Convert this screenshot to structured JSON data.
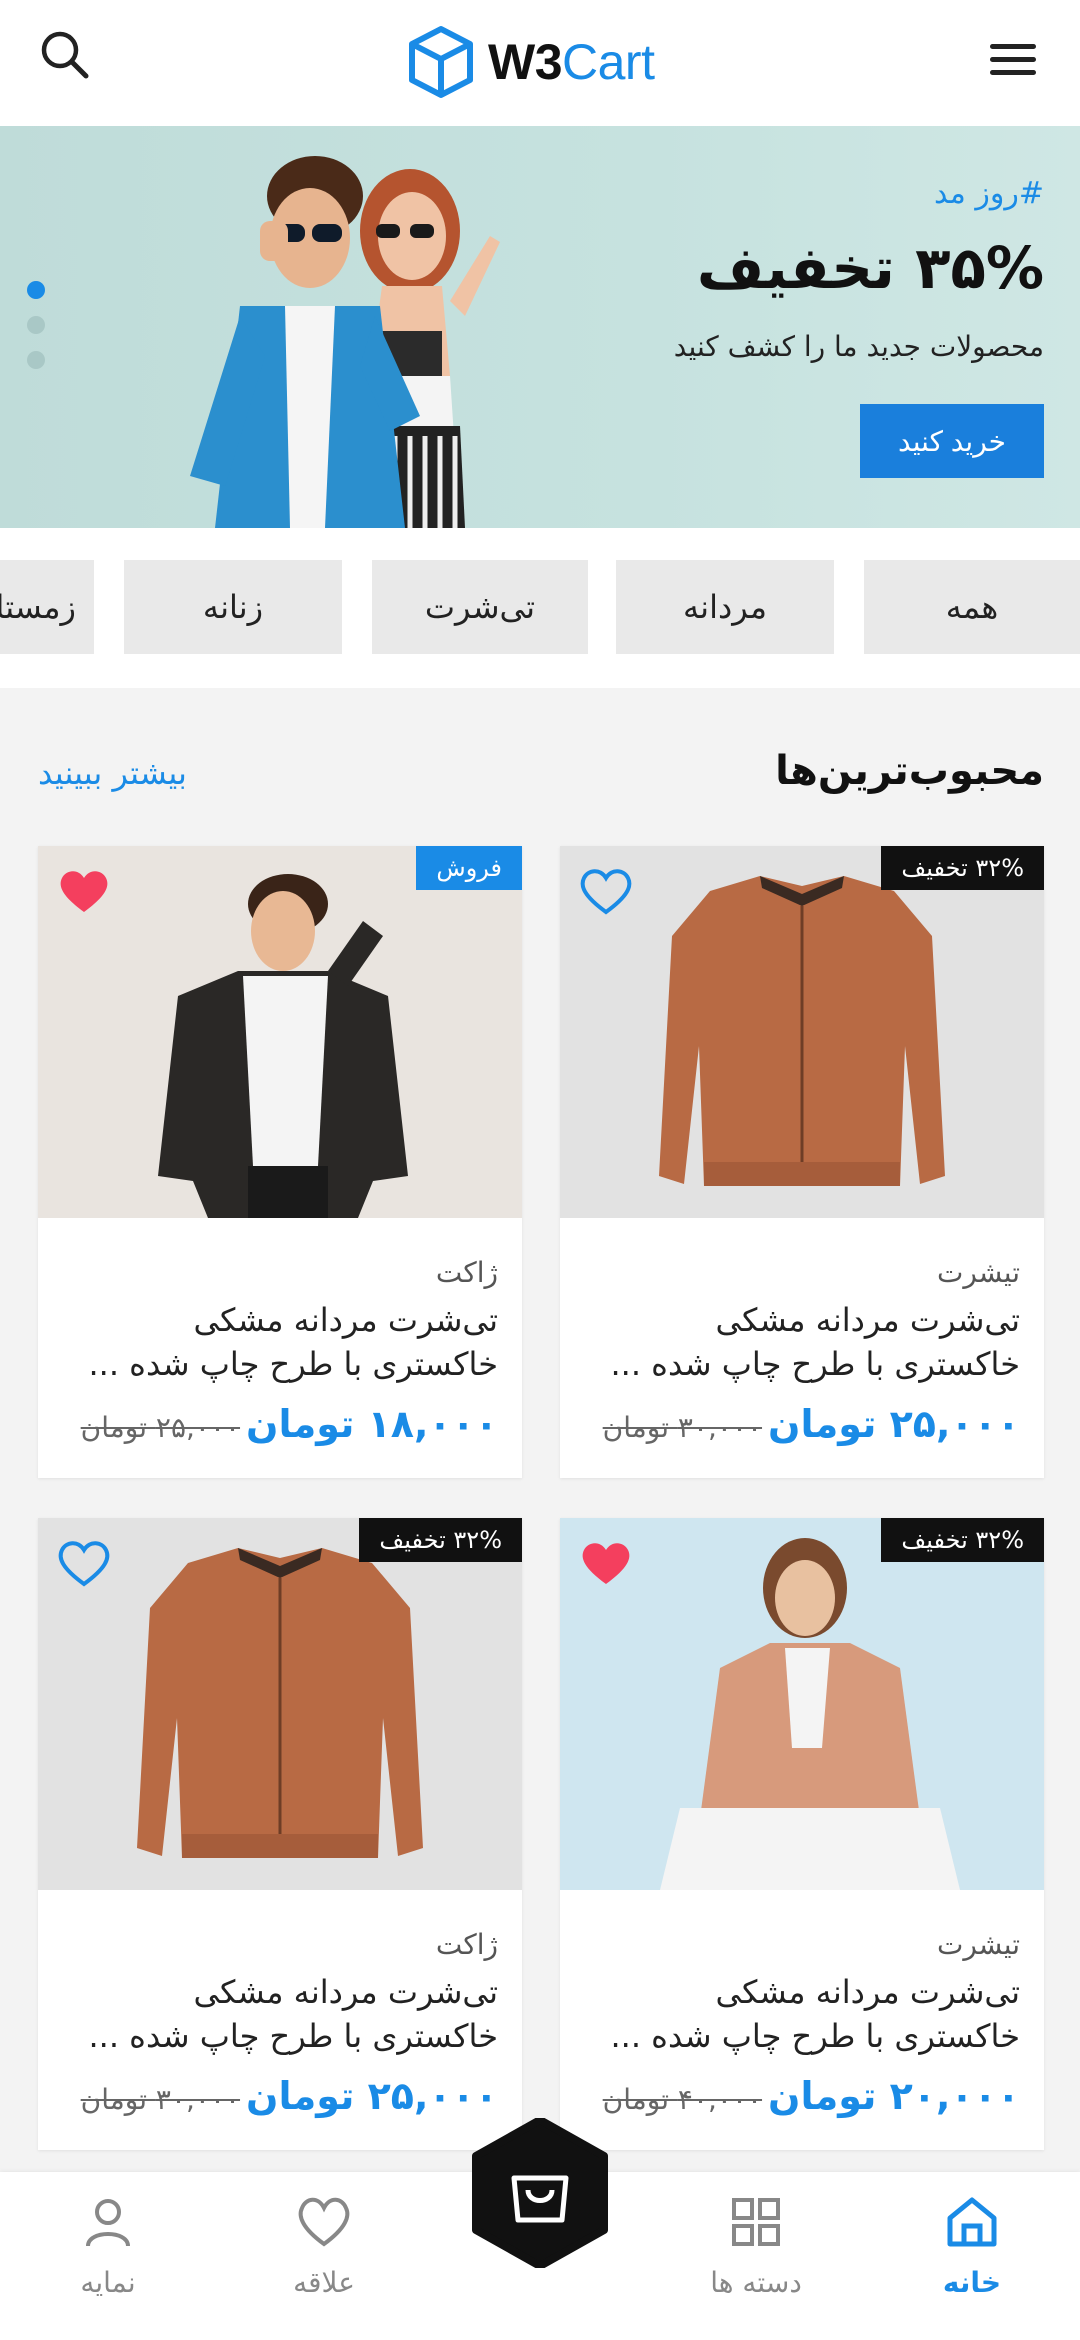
{
  "header": {
    "logo_brand": "W3",
    "logo_accent": "Cart"
  },
  "banner": {
    "tag": "#روز مد",
    "headline": "۳۵% تخفیف",
    "subtitle": "محصولات جدید ما را کشف کنید",
    "button": "خرید کنید",
    "slides": 3,
    "active_slide": 1
  },
  "categories": [
    "همه",
    "مردانه",
    "تی‌شرت",
    "زنانه",
    "زمستانه"
  ],
  "section": {
    "title": "محبوب‌ترین‌ها",
    "see_more": "بیشتر ببینید"
  },
  "products": [
    {
      "badge": "۳۲% تخفیف",
      "category": "تیشرت",
      "title": "تی‌شرت مردانه مشکی خاکستری با طرح چاپ شده ...",
      "price": "۲۵,۰۰۰ تومان",
      "old_price": "۳۰,۰۰۰ تومان",
      "favorite": false
    },
    {
      "badge": "فروش",
      "category": "ژاکت",
      "title": "تی‌شرت مردانه مشکی خاکستری با طرح چاپ شده ...",
      "price": "۱۸,۰۰۰ تومان",
      "old_price": "۲۵,۰۰۰ تومان",
      "favorite": true
    },
    {
      "badge": "۳۲% تخفیف",
      "category": "تیشرت",
      "title": "تی‌شرت مردانه مشکی خاکستری با طرح چاپ شده ...",
      "price": "۲۰,۰۰۰ تومان",
      "old_price": "۴۰,۰۰۰ تومان",
      "favorite": true
    },
    {
      "badge": "۳۲% تخفیف",
      "category": "ژاکت",
      "title": "تی‌شرت مردانه مشکی خاکستری با طرح چاپ شده ...",
      "price": "۲۵,۰۰۰ تومان",
      "old_price": "۳۰,۰۰۰ تومان",
      "favorite": false
    }
  ],
  "bottom_nav": [
    {
      "label": "خانه",
      "icon": "home-icon",
      "active": true
    },
    {
      "label": "دسته ها",
      "icon": "grid-icon",
      "active": false
    },
    {
      "label": "علاقه",
      "icon": "heart-icon",
      "active": false
    },
    {
      "label": "نمایه",
      "icon": "user-icon",
      "active": false
    }
  ],
  "colors": {
    "accent": "#1a8be6",
    "button": "#1a7fdc",
    "favorite": "#f43f5e",
    "dark": "#111111"
  }
}
